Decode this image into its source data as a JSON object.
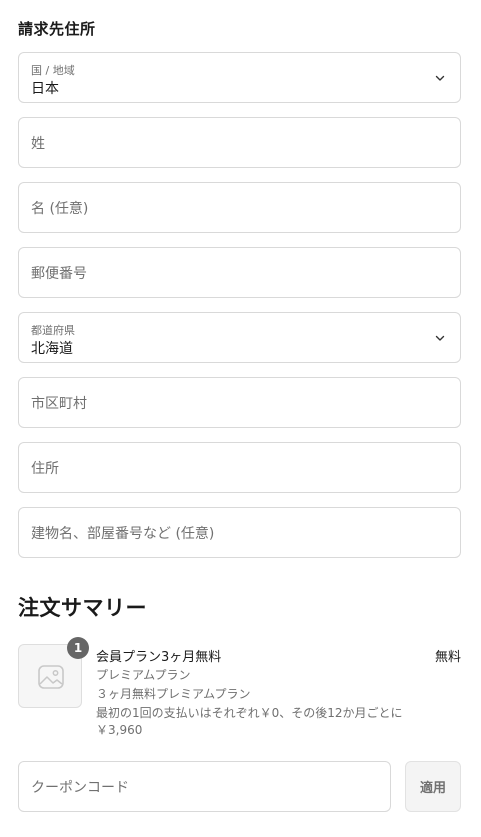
{
  "billing": {
    "heading": "請求先住所",
    "country": {
      "label": "国 / 地域",
      "value": "日本"
    },
    "last_name_placeholder": "姓",
    "first_name_placeholder": "名 (任意)",
    "postal_code_placeholder": "郵便番号",
    "prefecture": {
      "label": "都道府県",
      "value": "北海道"
    },
    "city_placeholder": "市区町村",
    "address_placeholder": "住所",
    "building_placeholder": "建物名、部屋番号など (任意)"
  },
  "summary": {
    "heading": "注文サマリー",
    "item": {
      "quantity": "1",
      "title": "会員プラン3ヶ月無料",
      "price": "無料",
      "subtitle": "プレミアムプラン",
      "description": "３ヶ月無料プレミアムプラン",
      "note_line1": "最初の1回の支払いはそれぞれ￥0、その後12か月ごとに",
      "note_line2": "￥3,960"
    },
    "coupon_placeholder": "クーポンコード",
    "apply_label": "適用"
  },
  "icons": {
    "chevron": "chevron-down-icon",
    "image_placeholder": "image-placeholder-icon"
  }
}
